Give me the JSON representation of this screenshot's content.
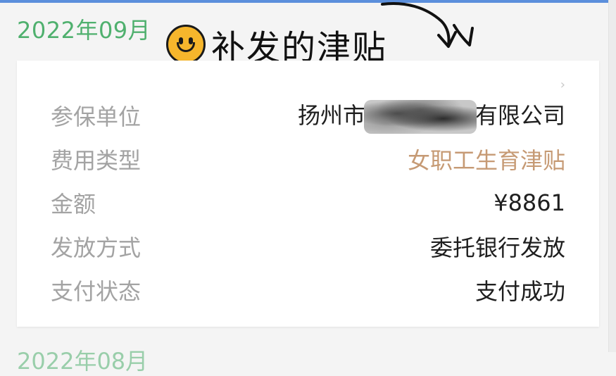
{
  "month_header": "2022年09月",
  "month_header_next": "2022年08月",
  "annotation": {
    "icon": "smiley-face-icon",
    "text": "补发的津贴"
  },
  "record": {
    "rows": [
      {
        "label": "参保单位",
        "value_prefix": "扬州市",
        "value_suffix": "有限公司",
        "redacted": true
      },
      {
        "label": "费用类型",
        "value": "女职工生育津贴",
        "color": "#c69a74"
      },
      {
        "label": "金额",
        "value": "¥8861"
      },
      {
        "label": "发放方式",
        "value": "委托银行发放"
      },
      {
        "label": "支付状态",
        "value": "支付成功"
      }
    ]
  },
  "colors": {
    "month": "#4fb06e",
    "label": "#a3a3a3",
    "value": "#1f1f1f",
    "accent_value": "#c69a74",
    "smiley": "#f6b62c"
  }
}
